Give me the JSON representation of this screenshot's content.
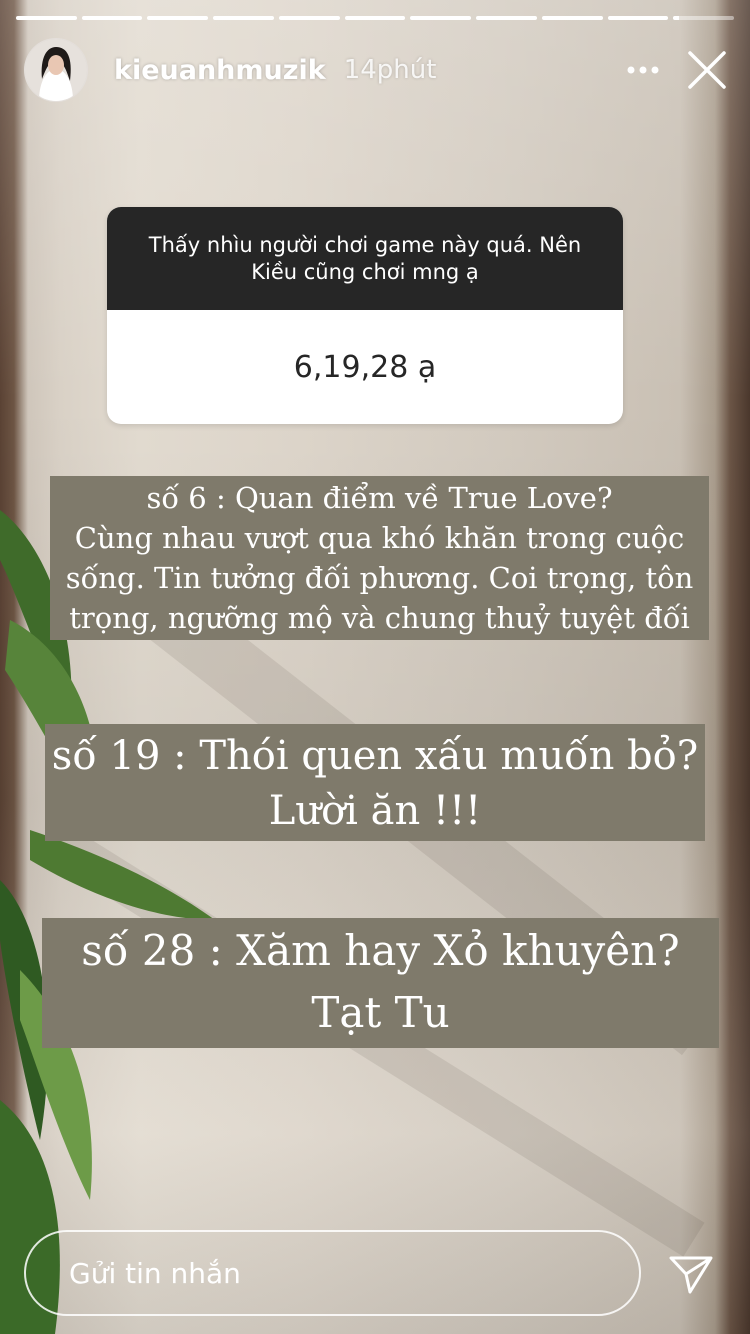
{
  "story": {
    "segments_total": 11,
    "segments_completed": 10,
    "current_segment_progress": 0.1
  },
  "header": {
    "username": "kieuanhmuzik",
    "time": "14phút"
  },
  "question_sticker": {
    "question_line1": "Thấy nhìu người chơi game này quá. Nên",
    "question_line2": "Kiều cũng chơi mng ạ",
    "answer": "6,19,28 ạ"
  },
  "text_boxes": {
    "box1": {
      "line1": "số 6 : Quan điểm về True Love?",
      "line2": "Cùng nhau vượt qua khó khăn trong cuộc",
      "line3": "sống. Tin tưởng đối phương. Coi trọng, tôn",
      "line4": "trọng, ngưỡng mộ và chung thuỷ tuyệt đối"
    },
    "box2": {
      "line1": "số 19 : Thói quen xấu muốn bỏ?",
      "line2": "Lười ăn !!!"
    },
    "box3": {
      "line1": "số 28 : Xăm hay Xỏ khuyên?",
      "line2": "Tạt Tu"
    }
  },
  "message_bar": {
    "placeholder": "Gửi tin nhắn"
  },
  "icons": {
    "more": "more-horizontal-icon",
    "close": "close-icon",
    "send": "send-icon"
  },
  "colors": {
    "text_box_bg": "#7f7a6b",
    "question_header_bg": "#262626"
  }
}
